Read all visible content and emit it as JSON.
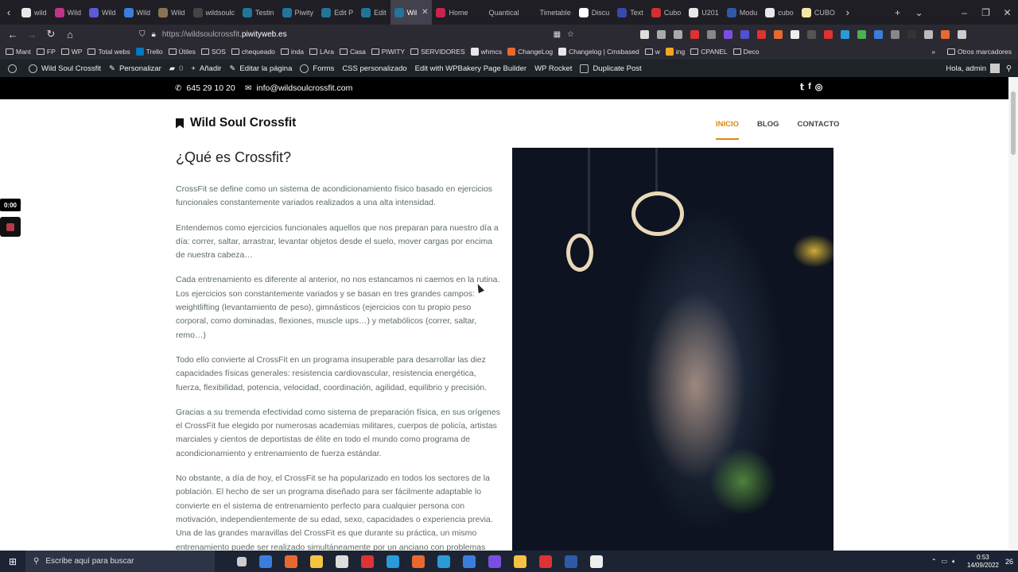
{
  "browser": {
    "tabs": [
      {
        "label": "wild",
        "color": "#e8e8e8"
      },
      {
        "label": "Wild",
        "color": "#c13584"
      },
      {
        "label": "Wild",
        "color": "#5b5bd6"
      },
      {
        "label": "Wild",
        "color": "#3b7ddd"
      },
      {
        "label": "Wild",
        "color": "#8a7355"
      },
      {
        "label": "wildsoulc",
        "color": "#444444"
      },
      {
        "label": "Testin",
        "color": "#21759b"
      },
      {
        "label": "Piwity",
        "color": "#21759b"
      },
      {
        "label": "Edit P",
        "color": "#21759b"
      },
      {
        "label": "Edit",
        "color": "#21759b"
      },
      {
        "label": "Wil",
        "color": "#21759b",
        "active": true
      },
      {
        "label": "Home",
        "color": "#c7254e"
      },
      {
        "label": "Quantical",
        "color": "#1f1e25"
      },
      {
        "label": "Timetable",
        "color": "#1f1e25"
      },
      {
        "label": "Discu",
        "color": "#ffffff"
      },
      {
        "label": "Text",
        "color": "#3949ab"
      },
      {
        "label": "Cubo",
        "color": "#d32f2f"
      },
      {
        "label": "U201",
        "color": "#e8e8e8"
      },
      {
        "label": "Modu",
        "color": "#2f5aa8"
      },
      {
        "label": "cubo",
        "color": "#e8e8e8"
      },
      {
        "label": "CUBO",
        "color": "#f5e7a1"
      }
    ],
    "url_prefix": "https://wildsoulcrossfit.",
    "url_host": "piwityweb.es",
    "bookmarks": [
      {
        "label": "Mant",
        "type": "folder"
      },
      {
        "label": "FP",
        "type": "folder"
      },
      {
        "label": "WP",
        "type": "folder"
      },
      {
        "label": "Total webs",
        "type": "folder"
      },
      {
        "label": "Trello",
        "type": "icon",
        "color": "#0079bf"
      },
      {
        "label": "Útiles",
        "type": "folder"
      },
      {
        "label": "SOS",
        "type": "folder"
      },
      {
        "label": "chequeado",
        "type": "folder"
      },
      {
        "label": "inda",
        "type": "folder"
      },
      {
        "label": "LAra",
        "type": "folder"
      },
      {
        "label": "Casa",
        "type": "folder"
      },
      {
        "label": "PIWITY",
        "type": "folder"
      },
      {
        "label": "SERVIDORES",
        "type": "folder"
      },
      {
        "label": "whmcs",
        "type": "icon",
        "color": "#e8e8e8"
      },
      {
        "label": "ChangeLog",
        "type": "icon",
        "color": "#e8692f"
      },
      {
        "label": "Changelog | Cmsbased",
        "type": "icon",
        "color": "#e8e8e8"
      },
      {
        "label": "w",
        "type": "folder"
      },
      {
        "label": "ing",
        "type": "icon",
        "color": "#f5a623"
      },
      {
        "label": "CPANEL",
        "type": "folder"
      },
      {
        "label": "Deco",
        "type": "folder"
      }
    ],
    "other_bookmarks": "Otros marcadores"
  },
  "wp_admin_bar": {
    "site_name": "Wild Soul Crossfit",
    "customize": "Personalizar",
    "comments": "0",
    "add_new": "Añadir",
    "edit_page": "Editar la página",
    "forms": "Forms",
    "custom_css": "CSS personalizado",
    "wpbakery": "Edit with WPBakery Page Builder",
    "wp_rocket": "WP Rocket",
    "duplicate": "Duplicate Post",
    "greeting": "Hola, admin"
  },
  "topbar": {
    "phone": "645 29 10 20",
    "email": "info@wildsoulcrossfit.com"
  },
  "site": {
    "logo": "Wild Soul Crossfit",
    "menu": [
      "INICIO",
      "BLOG",
      "CONTACTO"
    ],
    "title": "¿Qué es Crossfit?",
    "paragraphs": [
      "CrossFit se define como un sistema de acondicionamiento físico basado en ejercicios funcionales constantemente variados realizados a una alta intensidad.",
      "Entendemos como ejercicios funcionales aquellos que nos preparan para nuestro día a día: correr, saltar, arrastrar, levantar objetos desde el suelo, mover cargas por encima de nuestra cabeza…",
      "Cada entrenamiento es diferente al anterior, no nos estancamos ni caemos en la rutina. Los ejercicios son constantemente variados y se basan en tres grandes campos: weightlifting (levantamiento de peso), gimnásticos (ejercicios con tu propio peso corporal, como dominadas, flexiones, muscle ups…) y metabólicos (correr, saltar, remo…)",
      "Todo ello convierte al CrossFit en un programa insuperable para desarrollar las diez capacidades físicas generales: resistencia cardiovascular, resistencia energética, fuerza, flexibilidad, potencia, velocidad, coordinación, agilidad, equilibrio y precisión.",
      "Gracias a su tremenda efectividad como sistema de preparación física, en sus orígenes el CrossFit fue elegido por numerosas academias militares, cuerpos de policía, artistas marciales y cientos de deportistas de élite en todo el mundo como programa de acondicionamiento y entrenamiento de fuerza estándar.",
      "No obstante, a día de hoy, el CrossFit se ha popularizado en todos los sectores de la población. El hecho de ser un programa diseñado para ser fácilmente adaptable lo convierte en el sistema de entrenamiento perfecto para cualquier persona con motivación, independientemente de su edad, sexo, capacidades o experiencia previa. Una de las grandes maravillas del CrossFit es que durante su práctica, un mismo entrenamiento puede ser realizado simultáneamente por un anciano con problemas"
    ]
  },
  "recorder": {
    "time": "0:00"
  },
  "taskbar": {
    "search_placeholder": "Escribe aquí para buscar",
    "time": "0:53",
    "date": "14/09/2022",
    "notifications": "26"
  }
}
